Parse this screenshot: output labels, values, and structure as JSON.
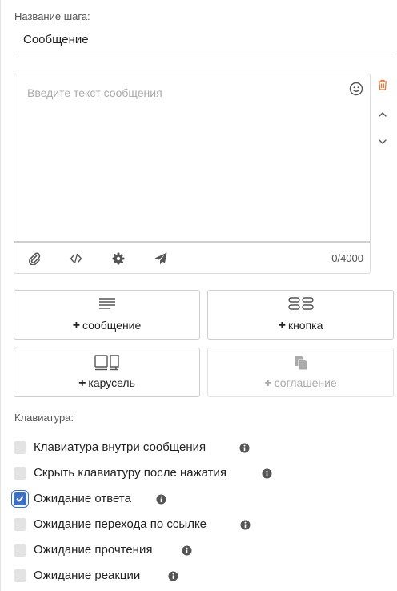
{
  "step": {
    "label": "Название шага:",
    "value": "Сообщение"
  },
  "editor": {
    "placeholder": "Введите текст сообщения",
    "char_count": "0/4000",
    "toolbar_icons": [
      "paperclip-icon",
      "code-icon",
      "gear-icon",
      "send-icon"
    ],
    "emoji_icon": "smiley-icon"
  },
  "side_controls": [
    "trash-icon",
    "chevron-up-icon",
    "chevron-down-icon"
  ],
  "add_buttons": [
    {
      "label": "сообщение",
      "icon": "lines-icon",
      "enabled": true
    },
    {
      "label": "кнопка",
      "icon": "buttons-icon",
      "enabled": true
    },
    {
      "label": "карусель",
      "icon": "carousel-icon",
      "enabled": true
    },
    {
      "label": "соглашение",
      "icon": "documents-icon",
      "enabled": false
    }
  ],
  "keyboard": {
    "label": "Клавиатура:",
    "options": [
      {
        "label": "Клавиатура внутри сообщения",
        "checked": false
      },
      {
        "label": "Скрыть клавиатуру после нажатия",
        "checked": false
      },
      {
        "label": "Ожидание ответа",
        "checked": true
      },
      {
        "label": "Ожидание перехода по ссылке",
        "checked": false
      },
      {
        "label": "Ожидание прочтения",
        "checked": false
      },
      {
        "label": "Ожидание реакции",
        "checked": false
      }
    ]
  },
  "colors": {
    "accent": "#3b6fc4",
    "danger": "#e07a3f",
    "icon": "#555555"
  }
}
